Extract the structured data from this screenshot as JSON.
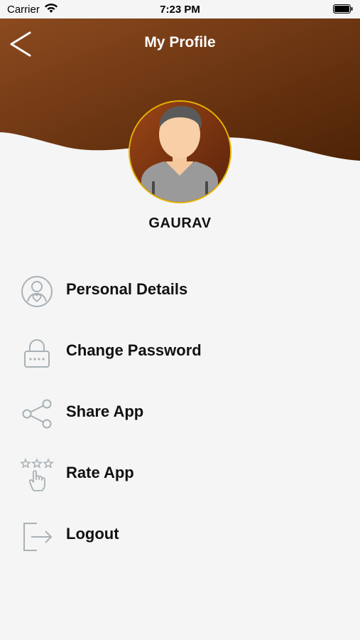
{
  "status_bar": {
    "carrier": "Carrier",
    "time": "7:23 PM"
  },
  "header": {
    "title": "My Profile",
    "gradient_start": "#8c4a1f",
    "gradient_end": "#4e2306"
  },
  "profile": {
    "name": "GAURAV",
    "avatar_ring_color": "#e8b400"
  },
  "menu": {
    "items": [
      {
        "label": "Personal Details",
        "icon": "person-heart-icon"
      },
      {
        "label": "Change Password",
        "icon": "lock-icon"
      },
      {
        "label": "Share App",
        "icon": "share-icon"
      },
      {
        "label": "Rate App",
        "icon": "rate-stars-icon"
      },
      {
        "label": "Logout",
        "icon": "logout-icon"
      }
    ]
  },
  "colors": {
    "background": "#f5f5f5",
    "icon_gray": "#a9b1b6",
    "text": "#111111"
  }
}
